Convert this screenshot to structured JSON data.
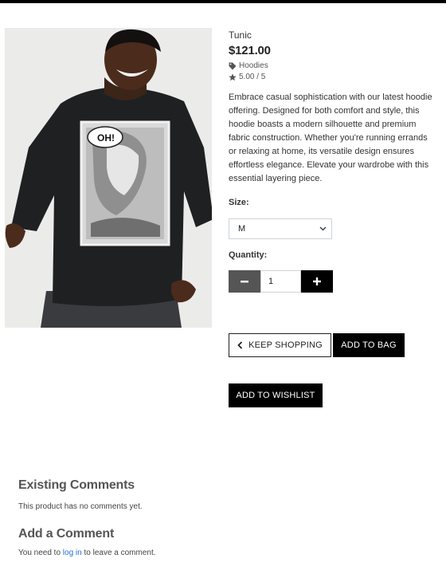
{
  "product": {
    "name": "Tunic",
    "price": "$121.00",
    "category": "Hoodies",
    "rating": "5.00 / 5",
    "description": "Embrace casual sophistication with our latest hoodie offering. Designed for both comfort and style, this hoodie boasts a modern silhouette and premium fabric construction. Whether you're running errands or relaxing at home, its versatile design ensures effortless elegance. Elevate your wardrobe with this essential layering piece.",
    "image_icon": "product-photo"
  },
  "form": {
    "size_label": "Size:",
    "size_value": "M",
    "quantity_label": "Quantity:",
    "quantity_value": "1"
  },
  "actions": {
    "keep_shopping": "KEEP SHOPPING",
    "add_to_bag": "ADD TO BAG",
    "add_to_wishlist": "ADD TO WISHLIST"
  },
  "comments": {
    "existing_title": "Existing Comments",
    "existing_text": "This product has no comments yet.",
    "add_title": "Add a Comment",
    "login_prefix": "You need to ",
    "login_link": "log in",
    "login_suffix": " to leave a comment."
  },
  "colors": {
    "accent": "#000000",
    "link": "#1e6fd9",
    "minus_button": "#555555"
  }
}
